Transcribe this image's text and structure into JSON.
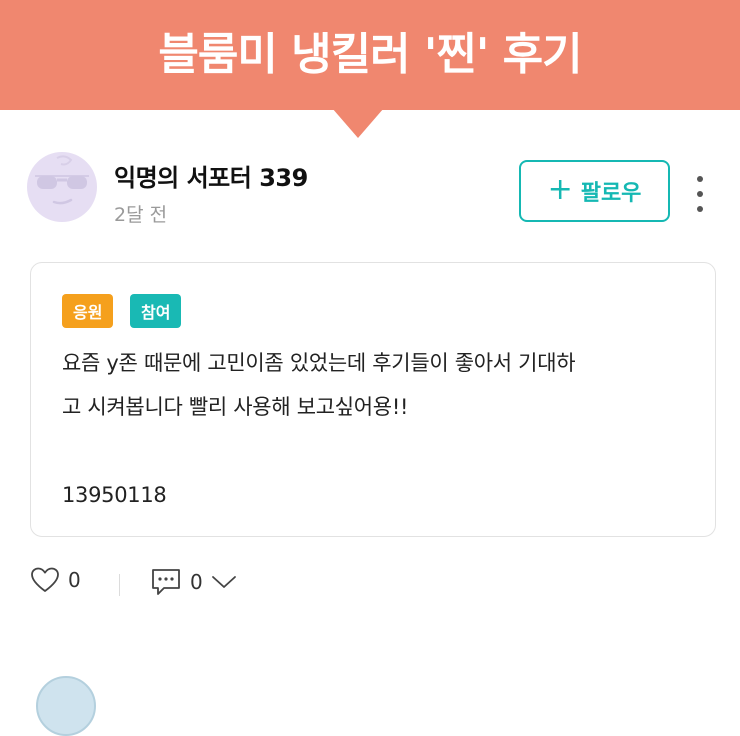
{
  "banner": {
    "title": "블룸미 냉킬러 '찐' 후기"
  },
  "post": {
    "author": "익명의 서포터 339",
    "time": "2달 전",
    "follow_label": "팔로우",
    "tags": [
      {
        "label": "응원",
        "color": "#f5a01d"
      },
      {
        "label": "참여",
        "color": "#19b9b4"
      }
    ],
    "body": "요즘 y존 때문에 고민이좀 있었는데 후기들이 좋아서 기대하\n고 시켜봅니다 빨리 사용해 보고싶어용!!\n\n13950118",
    "like_count": "0",
    "comment_count": "0"
  },
  "colors": {
    "banner": "#f0876f",
    "accent": "#15b8b3",
    "cheer_tag": "#f5a01d"
  },
  "icons": [
    "plus-icon",
    "more-vertical-icon",
    "heart-icon",
    "comment-icon",
    "chevron-down-icon"
  ]
}
